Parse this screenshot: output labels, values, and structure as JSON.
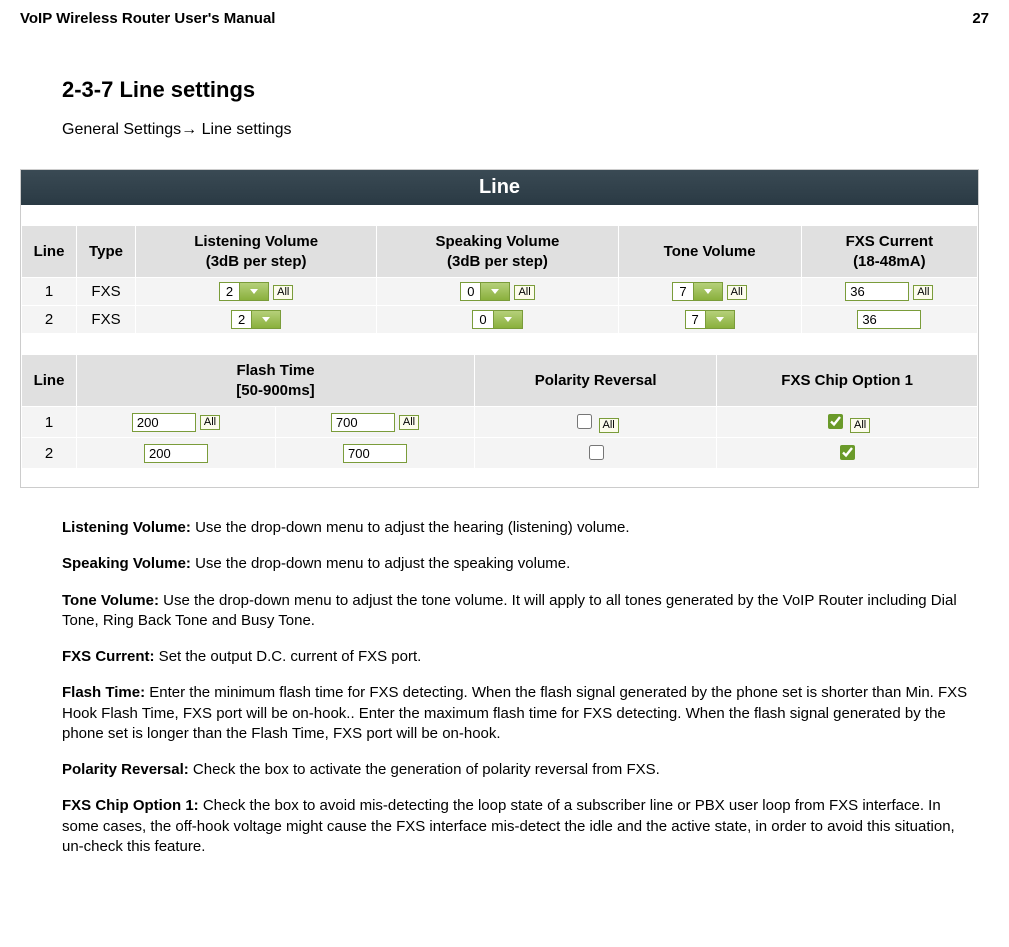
{
  "header": {
    "title": "VoIP Wireless Router User's Manual",
    "page": "27"
  },
  "section": {
    "title": "2-3-7 Line settings",
    "breadcrumb": "General Settings→  Line settings"
  },
  "panel": {
    "title": "Line"
  },
  "table1": {
    "headers": {
      "line": "Line",
      "type": "Type",
      "listening": "Listening Volume",
      "listening_sub": "(3dB per step)",
      "speaking": "Speaking Volume",
      "speaking_sub": "(3dB per step)",
      "tone": "Tone Volume",
      "fxs": "FXS Current",
      "fxs_sub": "(18-48mA)"
    },
    "rows": [
      {
        "line": "1",
        "type": "FXS",
        "listening": "2",
        "speaking": "0",
        "tone": "7",
        "fxs": "36",
        "all": true
      },
      {
        "line": "2",
        "type": "FXS",
        "listening": "2",
        "speaking": "0",
        "tone": "7",
        "fxs": "36",
        "all": false
      }
    ]
  },
  "table2": {
    "headers": {
      "line": "Line",
      "flash": "Flash Time",
      "flash_sub": "[50-900ms]",
      "polarity": "Polarity Reversal",
      "chip": "FXS Chip Option 1"
    },
    "rows": [
      {
        "line": "1",
        "flash_min": "200",
        "flash_max": "700",
        "polarity": false,
        "chip": true,
        "all": true
      },
      {
        "line": "2",
        "flash_min": "200",
        "flash_max": "700",
        "polarity": false,
        "chip": true,
        "all": false
      }
    ]
  },
  "all_label": "All",
  "desc": {
    "listening_t": "Listening Volume:",
    "listening": " Use the drop-down menu to adjust the hearing (listening) volume.",
    "speaking_t": "Speaking Volume:",
    "speaking": " Use the drop-down menu to adjust the speaking volume.",
    "tone_t": "Tone Volume:",
    "tone": " Use the drop-down menu to adjust the tone volume. It will apply to all tones generated by the VoIP Router including Dial Tone, Ring Back Tone and Busy Tone.",
    "fxs_t": "FXS Current:",
    "fxs": " Set the output D.C. current of FXS port.",
    "flash_t": "Flash Time:",
    "flash": " Enter the minimum flash time for FXS detecting. When the flash signal generated by the phone set is shorter than Min. FXS Hook Flash Time, FXS port will be on-hook.. Enter the maximum flash time for FXS detecting. When the flash signal generated by the phone set is longer than the Flash Time, FXS port will be on-hook.",
    "polarity_t": "Polarity Reversal:",
    "polarity": " Check the box to activate the generation of polarity reversal from FXS.",
    "chip_t": "FXS Chip Option 1:",
    "chip": " Check the box to avoid mis-detecting the loop state of a subscriber line or PBX user loop from FXS interface. In some cases, the off-hook voltage might cause the FXS interface mis-detect the idle and the active state, in order to avoid this situation, un-check this feature."
  }
}
